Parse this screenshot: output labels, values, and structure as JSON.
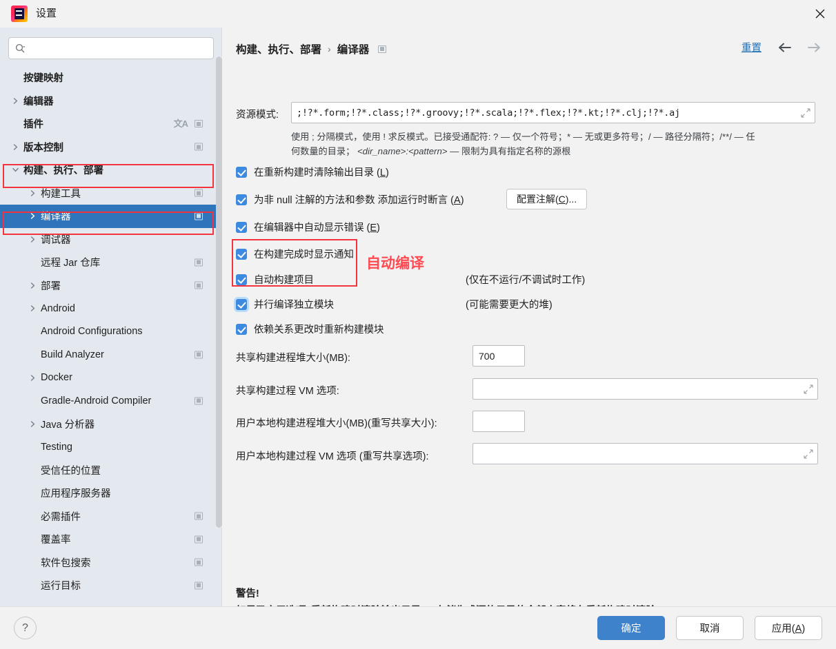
{
  "window": {
    "title": "设置",
    "close_label": "×",
    "app_icon": "intellij-idea-logo"
  },
  "sidebar": {
    "search": {
      "value": "",
      "placeholder": ""
    },
    "items": [
      {
        "label": "按键映射",
        "indent": 0,
        "arrow": "none",
        "bold": true,
        "selected": false,
        "badge": "none"
      },
      {
        "label": "编辑器",
        "indent": 0,
        "arrow": "collapsed",
        "bold": true,
        "selected": false,
        "badge": "none"
      },
      {
        "label": "插件",
        "indent": 0,
        "arrow": "none",
        "bold": true,
        "selected": false,
        "badge": "square",
        "translate": true
      },
      {
        "label": "版本控制",
        "indent": 0,
        "arrow": "collapsed",
        "bold": true,
        "selected": false,
        "badge": "square"
      },
      {
        "label": "构建、执行、部署",
        "indent": 0,
        "arrow": "expanded",
        "bold": true,
        "selected": false,
        "badge": "none"
      },
      {
        "label": "构建工具",
        "indent": 1,
        "arrow": "collapsed",
        "bold": false,
        "selected": false,
        "badge": "square"
      },
      {
        "label": "编译器",
        "indent": 1,
        "arrow": "collapsed",
        "bold": false,
        "selected": true,
        "badge": "square"
      },
      {
        "label": "调试器",
        "indent": 1,
        "arrow": "collapsed",
        "bold": false,
        "selected": false,
        "badge": "none"
      },
      {
        "label": "远程 Jar 仓库",
        "indent": 1,
        "arrow": "none",
        "bold": false,
        "selected": false,
        "badge": "square"
      },
      {
        "label": "部署",
        "indent": 1,
        "arrow": "collapsed",
        "bold": false,
        "selected": false,
        "badge": "square"
      },
      {
        "label": "Android",
        "indent": 1,
        "arrow": "collapsed",
        "bold": false,
        "selected": false,
        "badge": "none"
      },
      {
        "label": "Android Configurations",
        "indent": 1,
        "arrow": "none",
        "bold": false,
        "selected": false,
        "badge": "none"
      },
      {
        "label": "Build Analyzer",
        "indent": 1,
        "arrow": "none",
        "bold": false,
        "selected": false,
        "badge": "square"
      },
      {
        "label": "Docker",
        "indent": 1,
        "arrow": "collapsed",
        "bold": false,
        "selected": false,
        "badge": "none"
      },
      {
        "label": "Gradle-Android Compiler",
        "indent": 1,
        "arrow": "none",
        "bold": false,
        "selected": false,
        "badge": "square"
      },
      {
        "label": "Java 分析器",
        "indent": 1,
        "arrow": "collapsed",
        "bold": false,
        "selected": false,
        "badge": "none"
      },
      {
        "label": "Testing",
        "indent": 1,
        "arrow": "none",
        "bold": false,
        "selected": false,
        "badge": "none"
      },
      {
        "label": "受信任的位置",
        "indent": 1,
        "arrow": "none",
        "bold": false,
        "selected": false,
        "badge": "none"
      },
      {
        "label": "应用程序服务器",
        "indent": 1,
        "arrow": "none",
        "bold": false,
        "selected": false,
        "badge": "none"
      },
      {
        "label": "必需插件",
        "indent": 1,
        "arrow": "none",
        "bold": false,
        "selected": false,
        "badge": "square"
      },
      {
        "label": "覆盖率",
        "indent": 1,
        "arrow": "none",
        "bold": false,
        "selected": false,
        "badge": "square"
      },
      {
        "label": "软件包搜索",
        "indent": 1,
        "arrow": "none",
        "bold": false,
        "selected": false,
        "badge": "square"
      },
      {
        "label": "运行目标",
        "indent": 1,
        "arrow": "none",
        "bold": false,
        "selected": false,
        "badge": "square"
      }
    ]
  },
  "header": {
    "breadcrumb_parent": "构建、执行、部署",
    "breadcrumb_sep": "›",
    "breadcrumb_current": "编译器",
    "reset_label": "重置",
    "back_icon": "arrow-left-icon",
    "forward_icon": "arrow-right-icon"
  },
  "main": {
    "resource_patterns": {
      "label": "资源模式:",
      "value": ";!?*.form;!?*.class;!?*.groovy;!?*.scala;!?*.flex;!?*.kt;!?*.clj;!?*.aj",
      "placeholder": ""
    },
    "help_text_1": "使用 ; 分隔模式，使用 ! 求反模式。已接受通配符: ? — 仅一个符号；* — 无或更多符号；/ — 路径分隔符；/**/ — 任",
    "help_text_2a": "何数量的目录； ",
    "help_text_2b": "<dir_name>:<pattern>",
    "help_text_2c": " — 限制为具有指定名称的源根",
    "checkboxes": [
      {
        "label": "在重新构建时清除输出目录 (",
        "mnemonic": "L",
        "label_end": ")",
        "checked": true,
        "focused": false
      },
      {
        "label": "为非 null 注解的方法和参数 添加运行时断言 (",
        "mnemonic": "A",
        "label_end": ")",
        "checked": true,
        "focused": false
      },
      {
        "label": "在编辑器中自动显示错误 (",
        "mnemonic": "E",
        "label_end": ")",
        "checked": true,
        "focused": false
      },
      {
        "label": "在构建完成时显示通知",
        "mnemonic": "",
        "label_end": "",
        "checked": true,
        "focused": false
      },
      {
        "label": "自动构建项目",
        "mnemonic": "",
        "label_end": "",
        "checked": true,
        "focused": false
      },
      {
        "label": "并行编译独立模块",
        "mnemonic": "",
        "label_end": "",
        "checked": true,
        "focused": true
      },
      {
        "label": "依赖关系更改时重新构建模块",
        "mnemonic": "",
        "label_end": "",
        "checked": true,
        "focused": false
      }
    ],
    "configure_annotations_button": {
      "pre": "配置注解(",
      "mnemonic": "C",
      "post": ")..."
    },
    "note_auto_build": "(仅在不运行/不调试时工作)",
    "note_parallel": "(可能需要更大的堆)",
    "fields": [
      {
        "label": "共享构建进程堆大小(MB):",
        "value": "700",
        "kind": "small"
      },
      {
        "label": "共享构建过程 VM 选项:",
        "value": "",
        "kind": "wide"
      },
      {
        "label": "用户本地构建进程堆大小(MB)(重写共享大小):",
        "value": "",
        "kind": "small"
      },
      {
        "label": "用户本地构建过程 VM 选项 (重写共享选项):",
        "value": "",
        "kind": "wide"
      }
    ],
    "warning_title": "警告!",
    "warning_body": "如果已启用选项“重新构建时清除输出目录”，存储生成源的目录的全部内容将在重新构建时清除。"
  },
  "annotations": {
    "red_label": "自动编译",
    "red_color": "#f5333f"
  },
  "footer": {
    "help_icon": "question-mark-icon",
    "ok": "确定",
    "cancel": "取消",
    "apply_pre": "应用(",
    "apply_mnemonic": "A",
    "apply_post": ")"
  },
  "colors": {
    "accent_blue": "#3d82cb",
    "selection_blue": "#2f75bb",
    "link_blue": "#2470b3",
    "checkbox_blue": "#3d8ae0",
    "annotation_red": "#f5333f",
    "annotation_text_red": "#ff4a52",
    "sidebar_bg": "#e4e9ef",
    "panel_bg": "#f2f2f2"
  }
}
